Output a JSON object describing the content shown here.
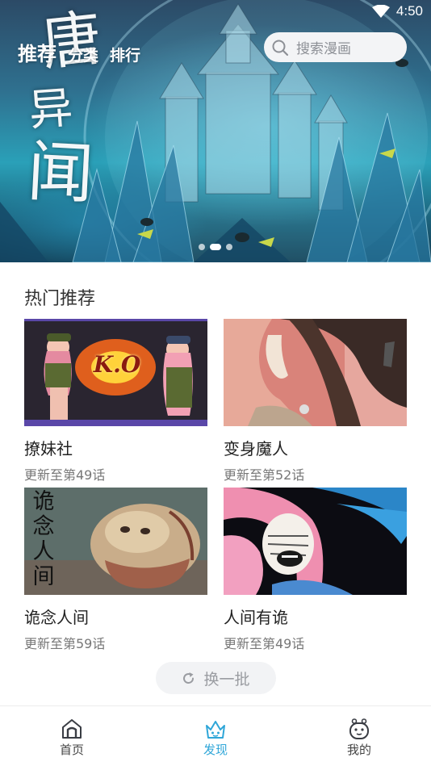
{
  "status_bar": {
    "time": "4:50",
    "wifi_icon": "wifi-icon"
  },
  "header": {
    "tabs": [
      {
        "label": "推荐",
        "active": true
      },
      {
        "label": "分类",
        "active": false
      },
      {
        "label": "排行",
        "active": false
      }
    ],
    "search": {
      "placeholder": "搜索漫画",
      "icon": "search-icon"
    }
  },
  "banner": {
    "calligraphy": [
      "唐",
      "异",
      "闻"
    ],
    "page_count": 3,
    "active_page": 1
  },
  "hot": {
    "title": "热门推荐",
    "items": [
      {
        "title": "撩妹社",
        "update": "更新至第49话"
      },
      {
        "title": "变身魔人",
        "update": "更新至第52话"
      },
      {
        "title": "诡念人间",
        "update": "更新至第59话"
      },
      {
        "title": "人间有诡",
        "update": "更新至第49话"
      }
    ],
    "cover_texts": {
      "item1": "K.O",
      "item3": [
        "诡",
        "念",
        "人",
        "间"
      ]
    },
    "refresh_label": "换一批",
    "refresh_icon": "refresh-icon"
  },
  "bottom_nav": [
    {
      "label": "首页",
      "icon": "home-icon",
      "active": false
    },
    {
      "label": "发现",
      "icon": "crown-icon",
      "active": true
    },
    {
      "label": "我的",
      "icon": "profile-icon",
      "active": false
    }
  ],
  "colors": {
    "accent": "#2fa6d8",
    "text_secondary": "#777777",
    "button_bg": "#f2f3f5"
  }
}
